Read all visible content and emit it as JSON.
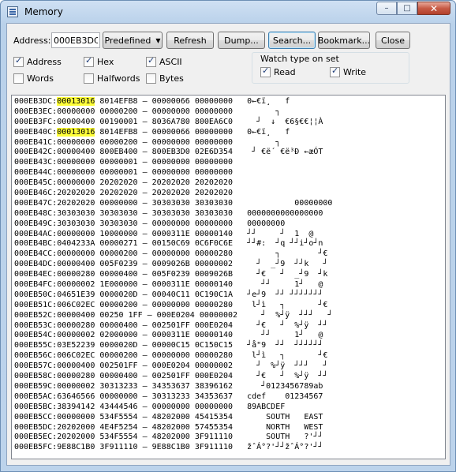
{
  "window": {
    "title": "Memory",
    "minimize_glyph": "–",
    "maximize_glyph": "□",
    "close_glyph": "✕"
  },
  "toolbar": {
    "address_label": "Address:",
    "address_value": "000EB3DC",
    "predefined_label": "Predefined",
    "refresh_label": "Refresh",
    "dump_label": "Dump...",
    "search_label": "Search...",
    "bookmark_label": "Bookmark...",
    "close_label": "Close"
  },
  "view_options": [
    {
      "label": "Address",
      "checked": true
    },
    {
      "label": "Hex",
      "checked": true
    },
    {
      "label": "ASCII",
      "checked": true
    },
    {
      "label": "Words",
      "checked": false
    },
    {
      "label": "Halfwords",
      "checked": false
    },
    {
      "label": "Bytes",
      "checked": false
    }
  ],
  "watch": {
    "title": "Watch type on set",
    "read": {
      "label": "Read",
      "checked": true
    },
    "write": {
      "label": "Write",
      "checked": true
    }
  },
  "highlight_color": "#ffff3a",
  "memory_rows": [
    {
      "addr": "000EB3DC",
      "w1": "00013016",
      "w1_hl": true,
      "w2": "8014EFB8",
      "w3": "00000066",
      "w4": "00000000",
      "ascii": "0←€ï¸   f"
    },
    {
      "addr": "000EB3EC",
      "w1": "00000000",
      "w1_hl": false,
      "w2": "00000200",
      "w3": "00000000",
      "w4": "00000000",
      "ascii": "      ┐"
    },
    {
      "addr": "000EB3FC",
      "w1": "00000400",
      "w1_hl": false,
      "w2": "00190001",
      "w3": "8036A780",
      "w4": "800EA6C0",
      "ascii": "  ┘  ↓  €6§€€¦¦À"
    },
    {
      "addr": "000EB40C",
      "w1": "00013016",
      "w1_hl": true,
      "w2": "8014EFB8",
      "w3": "00000066",
      "w4": "00000000",
      "ascii": "0←€ï¸   f"
    },
    {
      "addr": "000EB41C",
      "w1": "00000000",
      "w1_hl": false,
      "w2": "00000200",
      "w3": "00000000",
      "w4": "00000000",
      "ascii": "      ┐"
    },
    {
      "addr": "000EB42C",
      "w1": "00000400",
      "w1_hl": false,
      "w2": "800EB400",
      "w3": "800EB3D0",
      "w4": "02E6D354",
      "ascii": " ┘ €ë´ €ë³Ð ←æÓT"
    },
    {
      "addr": "000EB43C",
      "w1": "00000000",
      "w1_hl": false,
      "w2": "00000001",
      "w3": "00000000",
      "w4": "00000000",
      "ascii": ""
    },
    {
      "addr": "000EB44C",
      "w1": "00000000",
      "w1_hl": false,
      "w2": "00000001",
      "w3": "00000000",
      "w4": "00000000",
      "ascii": ""
    },
    {
      "addr": "000EB45C",
      "w1": "00000000",
      "w1_hl": false,
      "w2": "20202020",
      "w3": "20202020",
      "w4": "20202020",
      "ascii": ""
    },
    {
      "addr": "000EB46C",
      "w1": "20202020",
      "w1_hl": false,
      "w2": "20202020",
      "w3": "20202020",
      "w4": "20202020",
      "ascii": ""
    },
    {
      "addr": "000EB47C",
      "w1": "20202020",
      "w1_hl": false,
      "w2": "00000000",
      "w3": "30303030",
      "w4": "30303030",
      "ascii": "          00000000"
    },
    {
      "addr": "000EB48C",
      "w1": "30303030",
      "w1_hl": false,
      "w2": "30303030",
      "w3": "30303030",
      "w4": "30303030",
      "ascii": "0000000000000000"
    },
    {
      "addr": "000EB49C",
      "w1": "30303030",
      "w1_hl": false,
      "w2": "30303030",
      "w3": "00000000",
      "w4": "00000000",
      "ascii": "00000000"
    },
    {
      "addr": "000EB4AC",
      "w1": "00000000",
      "w1_hl": false,
      "w2": "10000000",
      "w3": "0000311E",
      "w4": "00000140",
      "ascii": "┘┘     ┘  1  @"
    },
    {
      "addr": "000EB4BC",
      "w1": "0404233A",
      "w1_hl": false,
      "w2": "00000271",
      "w3": "00150C69",
      "w4": "0C6F0C6E",
      "ascii": "┘┘#:  ┘q ┘┘i┘o┘n"
    },
    {
      "addr": "000EB4CC",
      "w1": "00000000",
      "w1_hl": false,
      "w2": "00000200",
      "w3": "00000000",
      "w4": "00000280",
      "ascii": "      ┐        ┘€"
    },
    {
      "addr": "000EB4DC",
      "w1": "00000400",
      "w1_hl": false,
      "w2": "005F0239",
      "w3": "0009026B",
      "w4": "00000002",
      "ascii": "  ┘  _┘9  ┘┘k   ┘"
    },
    {
      "addr": "000EB4EC",
      "w1": "00000280",
      "w1_hl": false,
      "w2": "00000400",
      "w3": "005F0239",
      "w4": "0009026B",
      "ascii": "  ┘€   ┘  _┘9  ┘k"
    },
    {
      "addr": "000EB4FC",
      "w1": "00000002",
      "w1_hl": false,
      "w2": "1E000000",
      "w3": "0000311E",
      "w4": "00000140",
      "ascii": "   ┘┘     1┘   @"
    },
    {
      "addr": "000EB50C",
      "w1": "04651E39",
      "w1_hl": false,
      "w2": "0000020D",
      "w3": "00040C11",
      "w4": "0C190C1A",
      "ascii": "┘e┘9  ┘┘ ┘┘┘┘┘┘┘"
    },
    {
      "addr": "000EB51C",
      "w1": "006C02EC",
      "w1_hl": false,
      "w2": "00000200",
      "w3": "00000000",
      "w4": "00000280",
      "ascii": " l┘ì   ┐       ┘€"
    },
    {
      "addr": "000EB52C",
      "w1": "00000400",
      "w1_hl": false,
      "w2": "00250 1FF",
      "w3": "000E0204",
      "w4": "00000002",
      "ascii": "  ┘  %┘ÿ  ┘┘┘   ┘"
    },
    {
      "addr": "000EB53C",
      "w1": "00000280",
      "w1_hl": false,
      "w2": "00000400",
      "w3": "002501FF",
      "w4": "000E0204",
      "ascii": "  ┘€   ┘  %┘ÿ  ┘┘"
    },
    {
      "addr": "000EB54C",
      "w1": "00000002",
      "w1_hl": false,
      "w2": "02000000",
      "w3": "0000311E",
      "w4": "00000140",
      "ascii": "   ┘┘     1┘   @"
    },
    {
      "addr": "000EB55C",
      "w1": "03E52239",
      "w1_hl": false,
      "w2": "0000020D",
      "w3": "00000C15",
      "w4": "0C150C15",
      "ascii": "┘å\"9  ┘┘  ┘┘┘┘┘┘"
    },
    {
      "addr": "000EB56C",
      "w1": "006C02EC",
      "w1_hl": false,
      "w2": "00000200",
      "w3": "00000000",
      "w4": "00000280",
      "ascii": " l┘ì   ┐       ┘€"
    },
    {
      "addr": "000EB57C",
      "w1": "00000400",
      "w1_hl": false,
      "w2": "002501FF",
      "w3": "000E0204",
      "w4": "00000002",
      "ascii": "  ┘  %┘ÿ  ┘┘┘   ┘"
    },
    {
      "addr": "000EB58C",
      "w1": "00000280",
      "w1_hl": false,
      "w2": "00000400",
      "w3": "002501FF",
      "w4": "000E0204",
      "ascii": "  ┘€   ┘  %┘ÿ  ┘┘"
    },
    {
      "addr": "000EB59C",
      "w1": "00000002",
      "w1_hl": false,
      "w2": "30313233",
      "w3": "34353637",
      "w4": "38396162",
      "ascii": "   ┘0123456789ab"
    },
    {
      "addr": "000EB5AC",
      "w1": "63646566",
      "w1_hl": false,
      "w2": "00000000",
      "w3": "30313233",
      "w4": "34353637",
      "ascii": "cdef    01234567"
    },
    {
      "addr": "000EB5BC",
      "w1": "38394142",
      "w1_hl": false,
      "w2": "43444546",
      "w3": "00000000",
      "w4": "00000000",
      "ascii": "89ABCDEF"
    },
    {
      "addr": "000EB5CC",
      "w1": "00000000",
      "w1_hl": false,
      "w2": "534F5554",
      "w3": "48202000",
      "w4": "45415354",
      "ascii": "    SOUTH   EAST"
    },
    {
      "addr": "000EB5DC",
      "w1": "20202000",
      "w1_hl": false,
      "w2": "4E4F5254",
      "w3": "48202000",
      "w4": "57455354",
      "ascii": "    NORTH   WEST"
    },
    {
      "addr": "000EB5EC",
      "w1": "20202000",
      "w1_hl": false,
      "w2": "534F5554",
      "w3": "48202000",
      "w4": "3F911110",
      "ascii": "    SOUTH   ?'┘┘"
    },
    {
      "addr": "000EB5FC",
      "w1": "9E88C1B0",
      "w1_hl": false,
      "w2": "3F911110",
      "w3": "9E88C1B0",
      "w4": "3F911110",
      "ascii": "žˆÁ°?'┘┘žˆÁ°?'┘┘"
    }
  ]
}
